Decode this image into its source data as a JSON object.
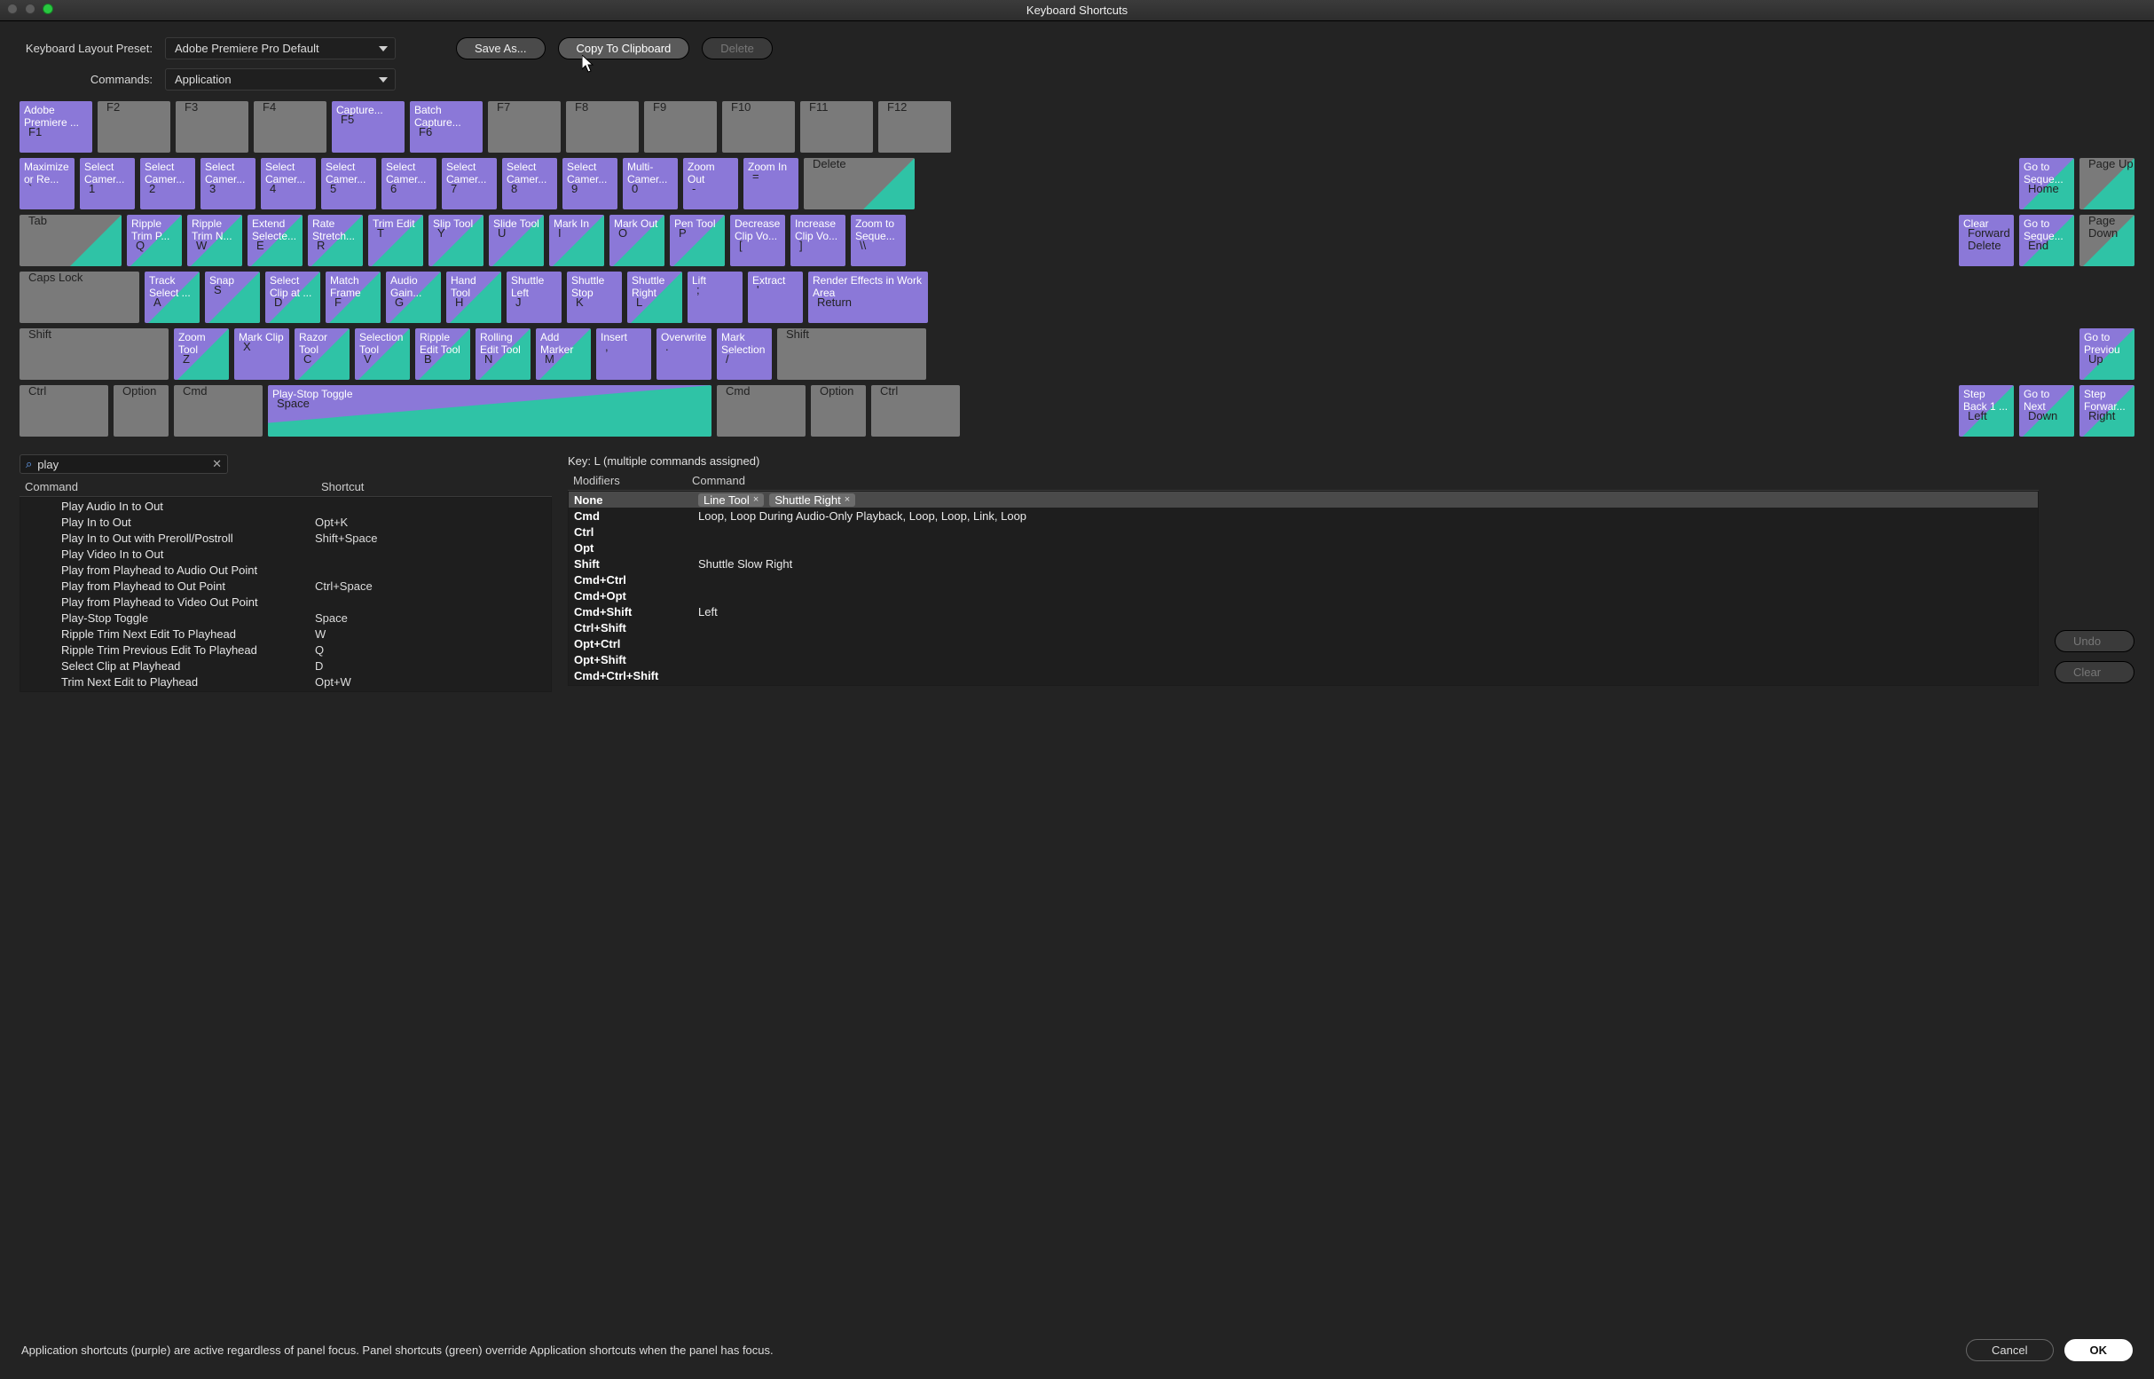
{
  "window": {
    "title": "Keyboard Shortcuts"
  },
  "labels": {
    "preset": "Keyboard Layout Preset:",
    "commands": "Commands:"
  },
  "dropdowns": {
    "preset": "Adobe Premiere Pro Default",
    "commands": "Application"
  },
  "buttons": {
    "save_as": "Save As...",
    "copy_clip": "Copy To Clipboard",
    "delete": "Delete",
    "undo": "Undo",
    "clear": "Clear",
    "cancel": "Cancel",
    "ok": "OK"
  },
  "hint": "Application shortcuts (purple) are active regardless of panel focus. Panel shortcuts (green) override Application shortcuts when the panel has focus.",
  "search": {
    "value": "play"
  },
  "headers": {
    "command": "Command",
    "shortcut": "Shortcut",
    "modifiers": "Modifiers"
  },
  "keyinfo": "Key:  L (multiple commands assigned)",
  "frow": [
    {
      "cmd": "Adobe Premiere ...",
      "lbl": "F1",
      "cls": "purple"
    },
    {
      "cmd": "",
      "lbl": "F2",
      "cls": "gray"
    },
    {
      "cmd": "",
      "lbl": "F3",
      "cls": "gray"
    },
    {
      "cmd": "",
      "lbl": "F4",
      "cls": "gray"
    },
    {
      "cmd": "Capture...",
      "lbl": "F5",
      "cls": "purple"
    },
    {
      "cmd": "Batch Capture...",
      "lbl": "F6",
      "cls": "purple"
    },
    {
      "cmd": "",
      "lbl": "F7",
      "cls": "gray"
    },
    {
      "cmd": "",
      "lbl": "F8",
      "cls": "gray"
    },
    {
      "cmd": "",
      "lbl": "F9",
      "cls": "gray"
    },
    {
      "cmd": "",
      "lbl": "F10",
      "cls": "gray"
    },
    {
      "cmd": "",
      "lbl": "F11",
      "cls": "gray"
    },
    {
      "cmd": "",
      "lbl": "F12",
      "cls": "gray"
    }
  ],
  "numrow": [
    {
      "cmd": "Maximize or Re...",
      "lbl": "`",
      "cls": "purple"
    },
    {
      "cmd": "Select Camer...",
      "lbl": "1",
      "cls": "purple"
    },
    {
      "cmd": "Select Camer...",
      "lbl": "2",
      "cls": "purple"
    },
    {
      "cmd": "Select Camer...",
      "lbl": "3",
      "cls": "purple"
    },
    {
      "cmd": "Select Camer...",
      "lbl": "4",
      "cls": "purple"
    },
    {
      "cmd": "Select Camer...",
      "lbl": "5",
      "cls": "purple"
    },
    {
      "cmd": "Select Camer...",
      "lbl": "6",
      "cls": "purple"
    },
    {
      "cmd": "Select Camer...",
      "lbl": "7",
      "cls": "purple"
    },
    {
      "cmd": "Select Camer...",
      "lbl": "8",
      "cls": "purple"
    },
    {
      "cmd": "Select Camer...",
      "lbl": "9",
      "cls": "purple"
    },
    {
      "cmd": "Multi-Camer...",
      "lbl": "0",
      "cls": "purple"
    },
    {
      "cmd": "Zoom Out",
      "lbl": "-",
      "cls": "purple"
    },
    {
      "cmd": "Zoom In",
      "lbl": "=",
      "cls": "purple"
    },
    {
      "cmd": "",
      "lbl": "Delete",
      "cls": "gray",
      "split": true,
      "w": "w125"
    }
  ],
  "numrow_nav": [
    {
      "cmd": "Go to Seque...",
      "lbl": "Home",
      "cls": "purple",
      "split": true
    },
    {
      "cmd": "",
      "lbl": "Page Up",
      "cls": "gray",
      "split": true
    }
  ],
  "qrow": [
    {
      "cmd": "",
      "lbl": "Tab",
      "cls": "gray",
      "split": true,
      "w": "w115"
    },
    {
      "cmd": "Ripple Trim P...",
      "lbl": "Q",
      "cls": "purple",
      "split": true
    },
    {
      "cmd": "Ripple Trim N...",
      "lbl": "W",
      "cls": "purple",
      "split": true
    },
    {
      "cmd": "Extend Selecte...",
      "lbl": "E",
      "cls": "purple",
      "split": true
    },
    {
      "cmd": "Rate Stretch...",
      "lbl": "R",
      "cls": "purple",
      "split": true
    },
    {
      "cmd": "Trim Edit",
      "lbl": "T",
      "cls": "purple",
      "split": true
    },
    {
      "cmd": "Slip Tool",
      "lbl": "Y",
      "cls": "purple",
      "split": true
    },
    {
      "cmd": "Slide Tool",
      "lbl": "U",
      "cls": "purple",
      "split": true
    },
    {
      "cmd": "Mark In",
      "lbl": "I",
      "cls": "purple",
      "split": true
    },
    {
      "cmd": "Mark Out",
      "lbl": "O",
      "cls": "purple",
      "split": true
    },
    {
      "cmd": "Pen Tool",
      "lbl": "P",
      "cls": "purple",
      "split": true
    },
    {
      "cmd": "Decrease Clip Vo...",
      "lbl": "[",
      "cls": "purple"
    },
    {
      "cmd": "Increase Clip Vo...",
      "lbl": "]",
      "cls": "purple"
    },
    {
      "cmd": "Zoom to Seque...",
      "lbl": "\\\\",
      "cls": "purple"
    }
  ],
  "qrow_nav": [
    {
      "cmd": "Clear",
      "sub": "Forward Delete",
      "lbl": "",
      "cls": "purple"
    },
    {
      "cmd": "Go to Seque...",
      "lbl": "End",
      "cls": "purple",
      "split": true
    },
    {
      "cmd": "",
      "lbl": "Page Down",
      "cls": "gray",
      "split": true
    }
  ],
  "arow": [
    {
      "cmd": "",
      "lbl": "Caps Lock",
      "cls": "gray",
      "w": "w135"
    },
    {
      "cmd": "Track Select ...",
      "lbl": "A",
      "cls": "purple",
      "split": true
    },
    {
      "cmd": "Snap",
      "lbl": "S",
      "cls": "purple",
      "split": true
    },
    {
      "cmd": "Select Clip at ...",
      "lbl": "D",
      "cls": "purple",
      "split": true
    },
    {
      "cmd": "Match Frame",
      "lbl": "F",
      "cls": "purple",
      "split": true
    },
    {
      "cmd": "Audio Gain...",
      "lbl": "G",
      "cls": "purple",
      "split": true
    },
    {
      "cmd": "Hand Tool",
      "lbl": "H",
      "cls": "purple",
      "split": true
    },
    {
      "cmd": "Shuttle Left",
      "lbl": "J",
      "cls": "purple"
    },
    {
      "cmd": "Shuttle Stop",
      "lbl": "K",
      "cls": "purple"
    },
    {
      "cmd": "Shuttle Right",
      "lbl": "L",
      "cls": "purple",
      "split": true
    },
    {
      "cmd": "Lift",
      "lbl": ";",
      "cls": "purple"
    },
    {
      "cmd": "Extract",
      "lbl": "'",
      "cls": "purple"
    },
    {
      "cmd": "Render Effects in Work Area",
      "lbl": "Return",
      "cls": "purple",
      "w": "w135"
    }
  ],
  "zrow": [
    {
      "cmd": "",
      "lbl": "Shift",
      "cls": "gray",
      "w": "w168"
    },
    {
      "cmd": "Zoom Tool",
      "lbl": "Z",
      "cls": "purple",
      "split": true
    },
    {
      "cmd": "Mark Clip",
      "lbl": "X",
      "cls": "purple"
    },
    {
      "cmd": "Razor Tool",
      "lbl": "C",
      "cls": "purple",
      "split": true
    },
    {
      "cmd": "Selection Tool",
      "lbl": "V",
      "cls": "purple",
      "split": true
    },
    {
      "cmd": "Ripple Edit Tool",
      "lbl": "B",
      "cls": "purple",
      "split": true
    },
    {
      "cmd": "Rolling Edit Tool",
      "lbl": "N",
      "cls": "purple",
      "split": true
    },
    {
      "cmd": "Add Marker",
      "lbl": "M",
      "cls": "purple",
      "split": true
    },
    {
      "cmd": "Insert",
      "lbl": ",",
      "cls": "purple"
    },
    {
      "cmd": "Overwrite",
      "lbl": ".",
      "cls": "purple"
    },
    {
      "cmd": "Mark Selection",
      "lbl": "/",
      "cls": "purple"
    },
    {
      "cmd": "",
      "lbl": "Shift",
      "cls": "gray",
      "w": "w168"
    }
  ],
  "zrow_nav": [
    {
      "cmd": "Go to Previou",
      "lbl": "Up",
      "cls": "purple",
      "split": true
    }
  ],
  "spacerow": [
    {
      "cmd": "",
      "lbl": "Ctrl",
      "cls": "gray",
      "w": "w100"
    },
    {
      "cmd": "",
      "lbl": "Option",
      "cls": "gray",
      "w": "w62"
    },
    {
      "cmd": "",
      "lbl": "Cmd",
      "cls": "gray",
      "w": "w100"
    },
    {
      "cmd": "Play-Stop Toggle",
      "lbl": "Space",
      "cls": "purple",
      "w": "wSpace",
      "spacewide": true
    },
    {
      "cmd": "",
      "lbl": "Cmd",
      "cls": "gray",
      "w": "w100"
    },
    {
      "cmd": "",
      "lbl": "Option",
      "cls": "gray",
      "w": "w62"
    },
    {
      "cmd": "",
      "lbl": "Ctrl",
      "cls": "gray",
      "w": "w100"
    }
  ],
  "spacerow_nav": [
    {
      "cmd": "Step Back 1 ...",
      "lbl": "Left",
      "cls": "purple",
      "split": true
    },
    {
      "cmd": "Go to Next",
      "lbl": "Down",
      "cls": "purple",
      "split": true
    },
    {
      "cmd": "Step Forwar...",
      "lbl": "Right",
      "cls": "purple",
      "split": true
    }
  ],
  "cmdlist": [
    {
      "c": "Play Audio In to Out",
      "s": ""
    },
    {
      "c": "Play In to Out",
      "s": "Opt+K"
    },
    {
      "c": "Play In to Out with Preroll/Postroll",
      "s": "Shift+Space"
    },
    {
      "c": "Play Video In to Out",
      "s": ""
    },
    {
      "c": "Play from Playhead to Audio Out Point",
      "s": ""
    },
    {
      "c": "Play from Playhead to Out Point",
      "s": "Ctrl+Space"
    },
    {
      "c": "Play from Playhead to Video Out Point",
      "s": ""
    },
    {
      "c": "Play-Stop Toggle",
      "s": "Space"
    },
    {
      "c": "Ripple Trim Next Edit To Playhead",
      "s": "W"
    },
    {
      "c": "Ripple Trim Previous Edit To Playhead",
      "s": "Q"
    },
    {
      "c": "Select Clip at Playhead",
      "s": "D"
    },
    {
      "c": "Trim Next Edit to Playhead",
      "s": "Opt+W"
    }
  ],
  "mods": [
    {
      "m": "None",
      "chips": [
        "Line Tool",
        "Shuttle Right"
      ],
      "sel": true
    },
    {
      "m": "Cmd",
      "txt": "Loop, Loop During Audio-Only Playback, Loop, Loop, Link, Loop"
    },
    {
      "m": "Ctrl",
      "txt": ""
    },
    {
      "m": "Opt",
      "txt": ""
    },
    {
      "m": "Shift",
      "txt": "Shuttle Slow Right"
    },
    {
      "m": "Cmd+Ctrl",
      "txt": ""
    },
    {
      "m": "Cmd+Opt",
      "txt": ""
    },
    {
      "m": "Cmd+Shift",
      "txt": "Left"
    },
    {
      "m": "Ctrl+Shift",
      "txt": ""
    },
    {
      "m": "Opt+Ctrl",
      "txt": ""
    },
    {
      "m": "Opt+Shift",
      "txt": ""
    },
    {
      "m": "Cmd+Ctrl+Shift",
      "txt": ""
    }
  ]
}
